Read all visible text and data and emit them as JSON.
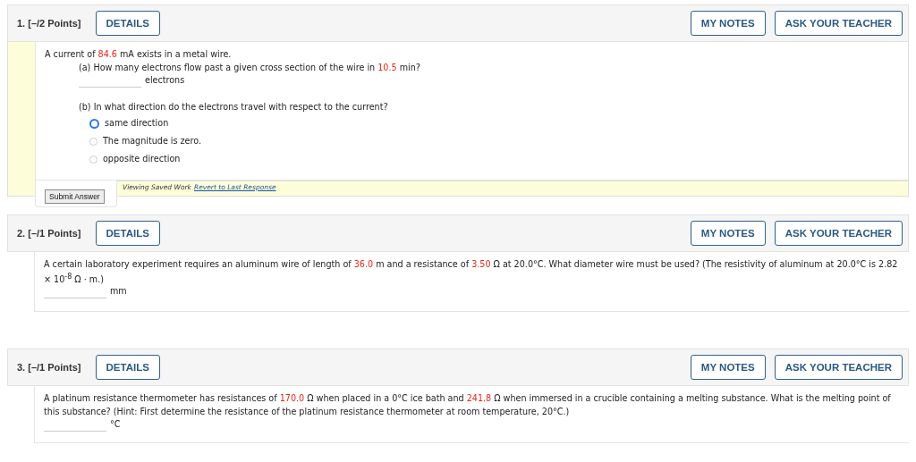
{
  "questions": [
    {
      "number": "1.",
      "points": "[–/2 Points]",
      "details_label": "DETAILS",
      "notes_label": "MY NOTES",
      "teacher_label": "ASK YOUR TEACHER",
      "blocks": [
        {
          "kind": "text",
          "indent": false,
          "segments": [
            {
              "text": "A current of "
            },
            {
              "text": "84.6",
              "highlight": true
            },
            {
              "text": " mA exists in a metal wire."
            }
          ]
        },
        {
          "kind": "text",
          "indent": true,
          "segments": [
            {
              "text": "(a) How many electrons flow past a given cross section of the wire in "
            },
            {
              "text": "10.5",
              "highlight": true
            },
            {
              "text": " min?"
            }
          ]
        },
        {
          "kind": "answer",
          "indent": true,
          "unit": "electrons"
        },
        {
          "kind": "text",
          "indent": true,
          "gap": true,
          "segments": [
            {
              "text": "(b) In what direction do the electrons travel with respect to the current?"
            }
          ]
        },
        {
          "kind": "choices",
          "indent": true,
          "options": [
            {
              "label": "same direction",
              "selected": true
            },
            {
              "label": "The magnitude is zero.",
              "selected": false
            },
            {
              "label": "opposite direction",
              "selected": false
            }
          ]
        }
      ],
      "submit_label": "Submit Answer",
      "saved_banner": {
        "text": "Viewing Saved Work",
        "link": "Revert to Last Response"
      }
    },
    {
      "number": "2.",
      "points": "[–/1 Points]",
      "details_label": "DETAILS",
      "notes_label": "MY NOTES",
      "teacher_label": "ASK YOUR TEACHER",
      "blocks": [
        {
          "kind": "text",
          "indent": false,
          "segments": [
            {
              "text": "A certain laboratory experiment requires an aluminum wire of length of "
            },
            {
              "text": "36.0",
              "highlight": true
            },
            {
              "text": " m and a resistance of "
            },
            {
              "text": "3.50",
              "highlight": true
            },
            {
              "text": " Ω at 20.0°C. What diameter wire must be used? (The resistivity of aluminum at 20.0°C is 2.82 × 10$^{-8}$ Ω · m.)"
            }
          ]
        },
        {
          "kind": "answer",
          "indent": false,
          "unit": "mm"
        }
      ]
    },
    {
      "number": "3.",
      "points": "[–/1 Points]",
      "details_label": "DETAILS",
      "notes_label": "MY NOTES",
      "teacher_label": "ASK YOUR TEACHER",
      "blocks": [
        {
          "kind": "text",
          "indent": false,
          "segments": [
            {
              "text": "A platinum resistance thermometer has resistances of "
            },
            {
              "text": "170.0",
              "highlight": true
            },
            {
              "text": " Ω when placed in a 0°C ice bath and "
            },
            {
              "text": "241.8",
              "highlight": true
            },
            {
              "text": " Ω when immersed in a crucible containing a melting substance. What is the melting point of this substance? (Hint: First determine the resistance of the platinum resistance thermometer at room temperature, 20°C.)"
            }
          ]
        },
        {
          "kind": "answer",
          "indent": false,
          "unit": "°C"
        }
      ]
    }
  ]
}
